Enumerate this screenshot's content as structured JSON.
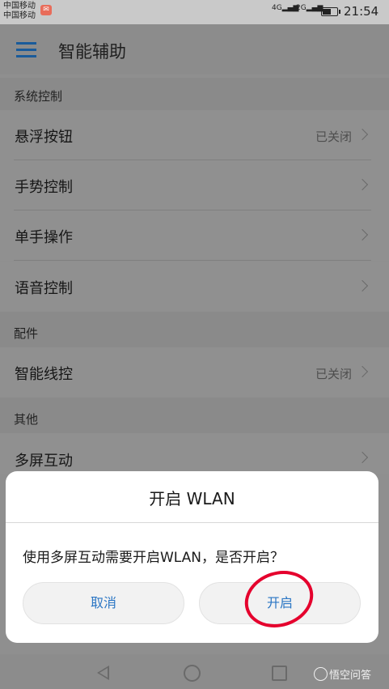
{
  "status_bar": {
    "carrier_1": "中国移动",
    "carrier_2": "中国移动",
    "signal_1": "4G",
    "signal_2": "2G",
    "time": "21:54"
  },
  "app_bar": {
    "title": "智能辅助"
  },
  "sections": [
    {
      "header": "系统控制",
      "rows": [
        {
          "label": "悬浮按钮",
          "value": "已关闭"
        },
        {
          "label": "手势控制",
          "value": ""
        },
        {
          "label": "单手操作",
          "value": ""
        },
        {
          "label": "语音控制",
          "value": ""
        }
      ]
    },
    {
      "header": "配件",
      "rows": [
        {
          "label": "智能线控",
          "value": "已关闭"
        }
      ]
    },
    {
      "header": "其他",
      "rows": [
        {
          "label": "多屏互动",
          "value": ""
        }
      ]
    }
  ],
  "dialog": {
    "title": "开启 WLAN",
    "message": "使用多屏互动需要开启WLAN，是否开启？",
    "cancel_label": "取消",
    "confirm_label": "开启"
  },
  "watermark": {
    "text": "悟空问答"
  },
  "colors": {
    "accent": "#2b76c4",
    "annotation": "#e5002d"
  }
}
